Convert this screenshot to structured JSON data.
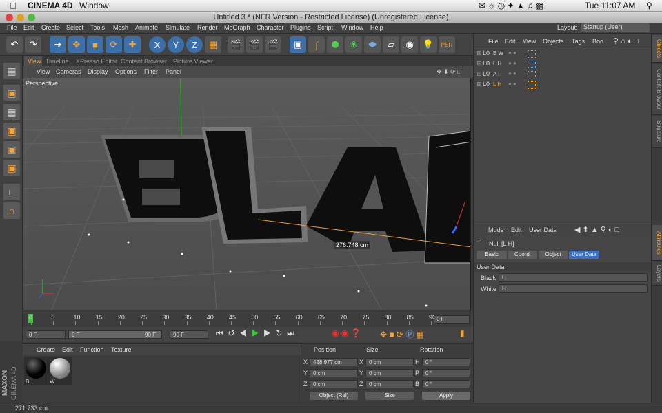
{
  "mac": {
    "app": "CINEMA 4D",
    "menu_window": "Window",
    "clock": "Tue 11:07 AM"
  },
  "window": {
    "title": "Untitled 3 * (NFR Version - Restricted License) (Unregistered License)"
  },
  "menu": [
    "File",
    "Edit",
    "Create",
    "Select",
    "Tools",
    "Mesh",
    "Animate",
    "Simulate",
    "Render",
    "MoGraph",
    "Character",
    "Plugins",
    "Script",
    "Window",
    "Help"
  ],
  "layout": {
    "label": "Layout:",
    "value": "Startup (User)"
  },
  "view_tabs": [
    "View",
    "Timeline",
    "XPresso Editor",
    "Content Browser",
    "Picture Viewer"
  ],
  "view_menu": [
    "View",
    "Cameras",
    "Display",
    "Options",
    "Filter",
    "Panel"
  ],
  "viewport": {
    "camera": "Perspective",
    "measure": "276.748 cm",
    "letters": [
      "B",
      "L",
      "A"
    ]
  },
  "timeline": {
    "ticks": [
      "0",
      "5",
      "10",
      "15",
      "20",
      "25",
      "30",
      "35",
      "40",
      "45",
      "50",
      "55",
      "60",
      "65",
      "70",
      "75",
      "80",
      "85",
      "90"
    ],
    "current": "0 F"
  },
  "anim": {
    "start": "0 F",
    "range_start": "0 F",
    "range_end": "90 F",
    "end": "90 F"
  },
  "materials": {
    "menu": [
      "Create",
      "Edit",
      "Function",
      "Texture"
    ],
    "items": [
      {
        "name": "B"
      },
      {
        "name": "W"
      }
    ]
  },
  "coords": {
    "headers": [
      "Position",
      "Size",
      "Rotation"
    ],
    "rows": [
      {
        "axis": "X",
        "pos": "428.977 cm",
        "saxis": "X",
        "size": "0 cm",
        "raxis": "H",
        "rot": "0 °"
      },
      {
        "axis": "Y",
        "pos": "0 cm",
        "saxis": "Y",
        "size": "0 cm",
        "raxis": "P",
        "rot": "0 °"
      },
      {
        "axis": "Z",
        "pos": "0 cm",
        "saxis": "Z",
        "size": "0 cm",
        "raxis": "B",
        "rot": "0 °"
      }
    ],
    "mode": "Object (Rel)",
    "size_mode": "Size",
    "apply": "Apply"
  },
  "objects": {
    "menu": [
      "File",
      "Edit",
      "View",
      "Objects",
      "Tags",
      "Boo"
    ],
    "items": [
      {
        "name": "B W",
        "selected": false
      },
      {
        "name": "L H",
        "selected": false
      },
      {
        "name": "A I",
        "selected": false
      },
      {
        "name": "L H",
        "selected": true
      }
    ]
  },
  "attributes": {
    "menu": [
      "Mode",
      "Edit",
      "User Data"
    ],
    "object": "Null [L H]",
    "tabs": [
      "Basic",
      "Coord.",
      "Object",
      "User Data"
    ],
    "section": "User Data",
    "fields": [
      {
        "label": "Black",
        "value": "L"
      },
      {
        "label": "White",
        "value": "H"
      }
    ]
  },
  "right_tabs": {
    "objects": "Objects",
    "content": "Content Browser",
    "structure": "Structure",
    "attributes": "Attributes",
    "layers": "Layers"
  },
  "status": "271.733 cm",
  "brand": {
    "line1": "MAXON",
    "line2": "CINEMA 4D"
  },
  "colors": {
    "accent": "#f3a43a",
    "selected_tab": "#3f6fbf",
    "toolbar_blue": "#3c6ea8"
  }
}
